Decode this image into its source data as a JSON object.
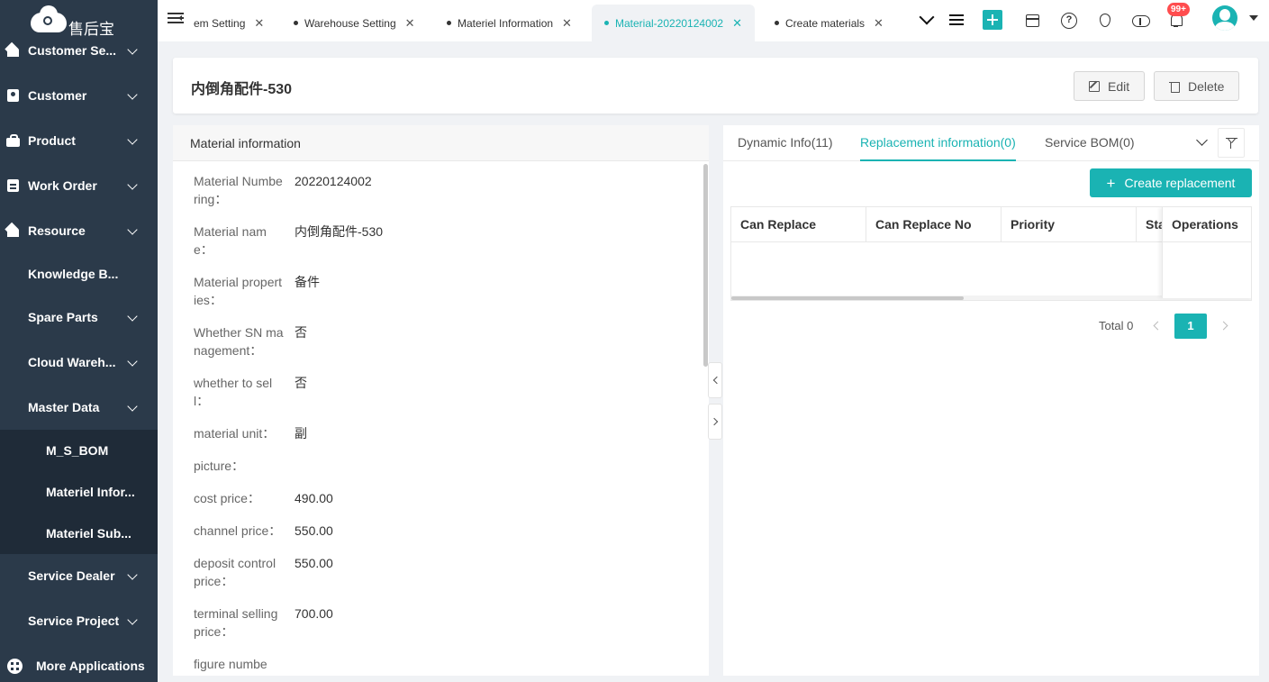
{
  "app": {
    "logo_text": "售后宝"
  },
  "sidebar": {
    "items": [
      {
        "label": "Customer Se...",
        "icon": "home-icon"
      },
      {
        "label": "Customer",
        "icon": "user-card-icon"
      },
      {
        "label": "Product",
        "icon": "bag-icon"
      },
      {
        "label": "Work Order",
        "icon": "doc-icon"
      },
      {
        "label": "Resource",
        "icon": "home-icon"
      },
      {
        "label": "Knowledge B..."
      },
      {
        "label": "Spare Parts"
      },
      {
        "label": "Cloud Wareh..."
      },
      {
        "label": "Master Data"
      },
      {
        "label": "M_S_BOM"
      },
      {
        "label": "Materiel Infor..."
      },
      {
        "label": "Materiel Sub..."
      },
      {
        "label": "Service Dealer"
      },
      {
        "label": "Service Project"
      }
    ],
    "more_apps": "More Applications"
  },
  "tabs": [
    {
      "label": "em Setting"
    },
    {
      "label": "Warehouse Setting"
    },
    {
      "label": "Materiel Information"
    },
    {
      "label": "Material-20220124002"
    },
    {
      "label": "Create materials"
    }
  ],
  "topbar": {
    "badge": "99+"
  },
  "header": {
    "title": "内倒角配件-530",
    "edit_label": "Edit",
    "delete_label": "Delete"
  },
  "material": {
    "panel_title": "Material information",
    "fields": [
      {
        "key": "Material Numbering：",
        "value": "20220124002"
      },
      {
        "key": "Material name：",
        "value": "内倒角配件-530"
      },
      {
        "key": "Material properties：",
        "value": "备件"
      },
      {
        "key": "Whether SN management：",
        "value": "否"
      },
      {
        "key": "whether to sell：",
        "value": "否"
      },
      {
        "key": "material unit：",
        "value": "副"
      },
      {
        "key": "picture：",
        "value": ""
      },
      {
        "key": "cost price：",
        "value": "490.00"
      },
      {
        "key": "channel price：",
        "value": "550.00"
      },
      {
        "key": "deposit control price：",
        "value": "550.00"
      },
      {
        "key": "terminal selling price：",
        "value": "700.00"
      },
      {
        "key": "figure numbe",
        "value": ""
      }
    ]
  },
  "right": {
    "tabs": [
      {
        "label": "Dynamic Info(11)"
      },
      {
        "label": "Replacement information(0)"
      },
      {
        "label": "Service BOM(0)"
      }
    ],
    "create_label": "Create replacement",
    "columns": [
      "Can Replace",
      "Can Replace No",
      "Priority",
      "Sta"
    ],
    "fixed_column": "Operations",
    "total": "Total 0",
    "page": "1"
  },
  "colors": {
    "accent": "#1ab3b3",
    "sidebar": "#2b3a4a",
    "sidebar_sub": "#1f2b38",
    "badge": "#ff4d4f"
  }
}
